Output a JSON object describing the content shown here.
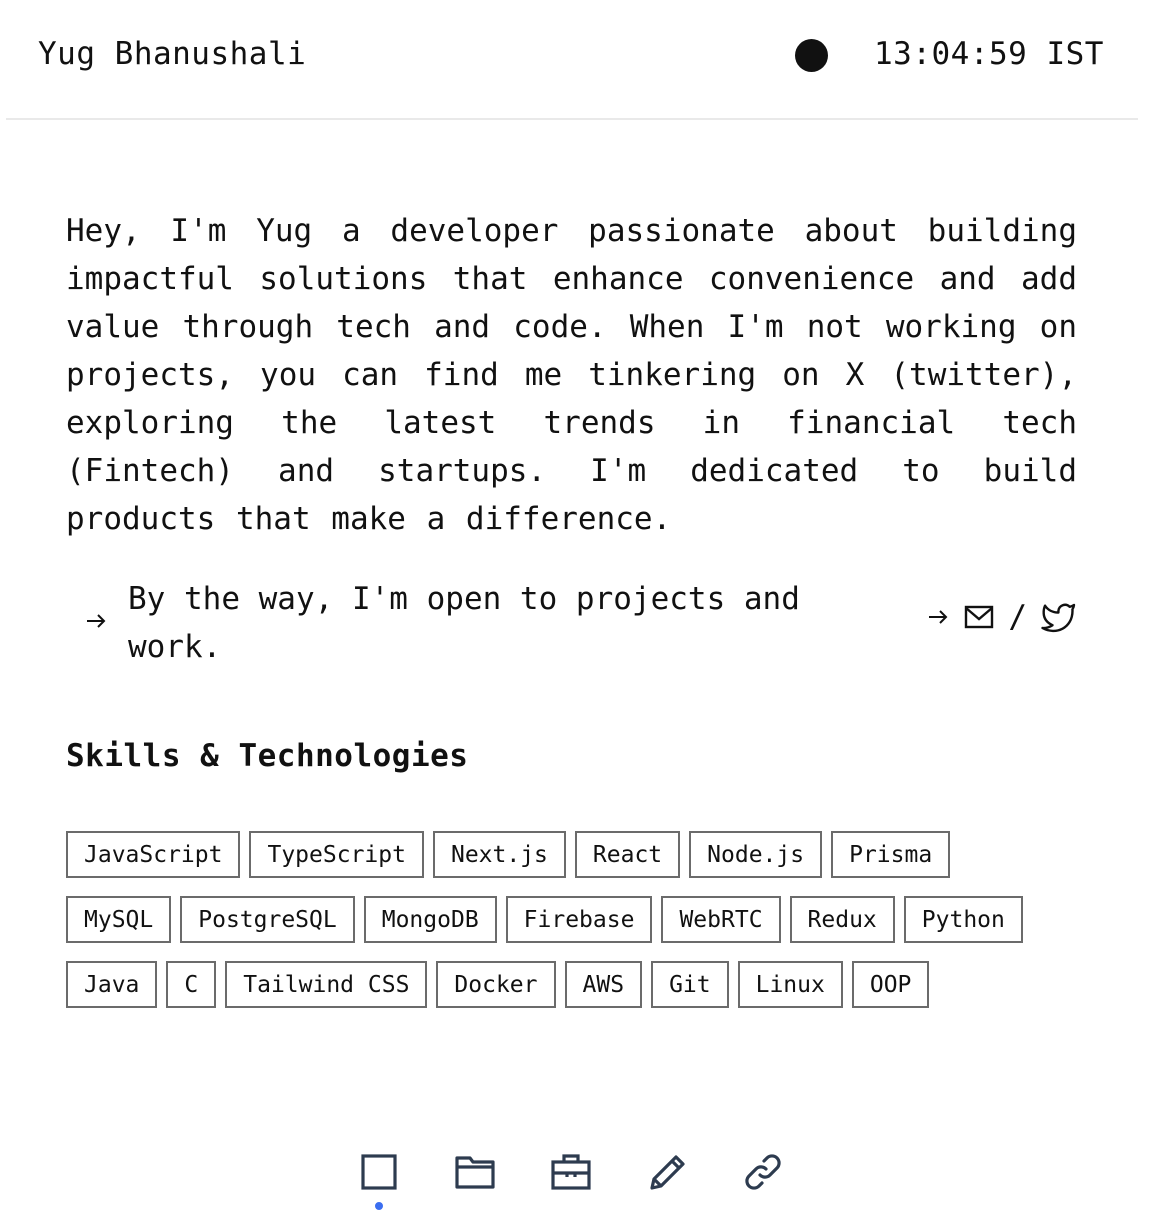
{
  "header": {
    "name": "Yug Bhanushali",
    "theme_toggle_icon": "filled-circle-icon",
    "clock": "13:04:59 IST"
  },
  "bio": {
    "text": "Hey, I'm Yug a developer passionate about building impactful solutions that enhance convenience and add value through tech and code. When I'm not working on projects, you can find me tinkering on X (twitter), exploring the latest trends in financial tech (Fintech) and startups. I'm dedicated to build products that make a difference."
  },
  "open": {
    "text": "By the way, I'm open to projects and work.",
    "separator": "/",
    "icons": [
      "arrow-right-icon",
      "mail-icon",
      "twitter-icon"
    ]
  },
  "skills": {
    "title": "Skills & Technologies",
    "items": [
      "JavaScript",
      "TypeScript",
      "Next.js",
      "React",
      "Node.js",
      "Prisma",
      "MySQL",
      "PostgreSQL",
      "MongoDB",
      "Firebase",
      "WebRTC",
      "Redux",
      "Python",
      "Java",
      "C",
      "Tailwind CSS",
      "Docker",
      "AWS",
      "Git",
      "Linux",
      "OOP"
    ]
  },
  "dock": {
    "items": [
      "home-square-icon",
      "folder-icon",
      "briefcase-icon",
      "pencil-icon",
      "link-icon"
    ],
    "active_index": 0,
    "active_color": "#3b6ef0"
  }
}
